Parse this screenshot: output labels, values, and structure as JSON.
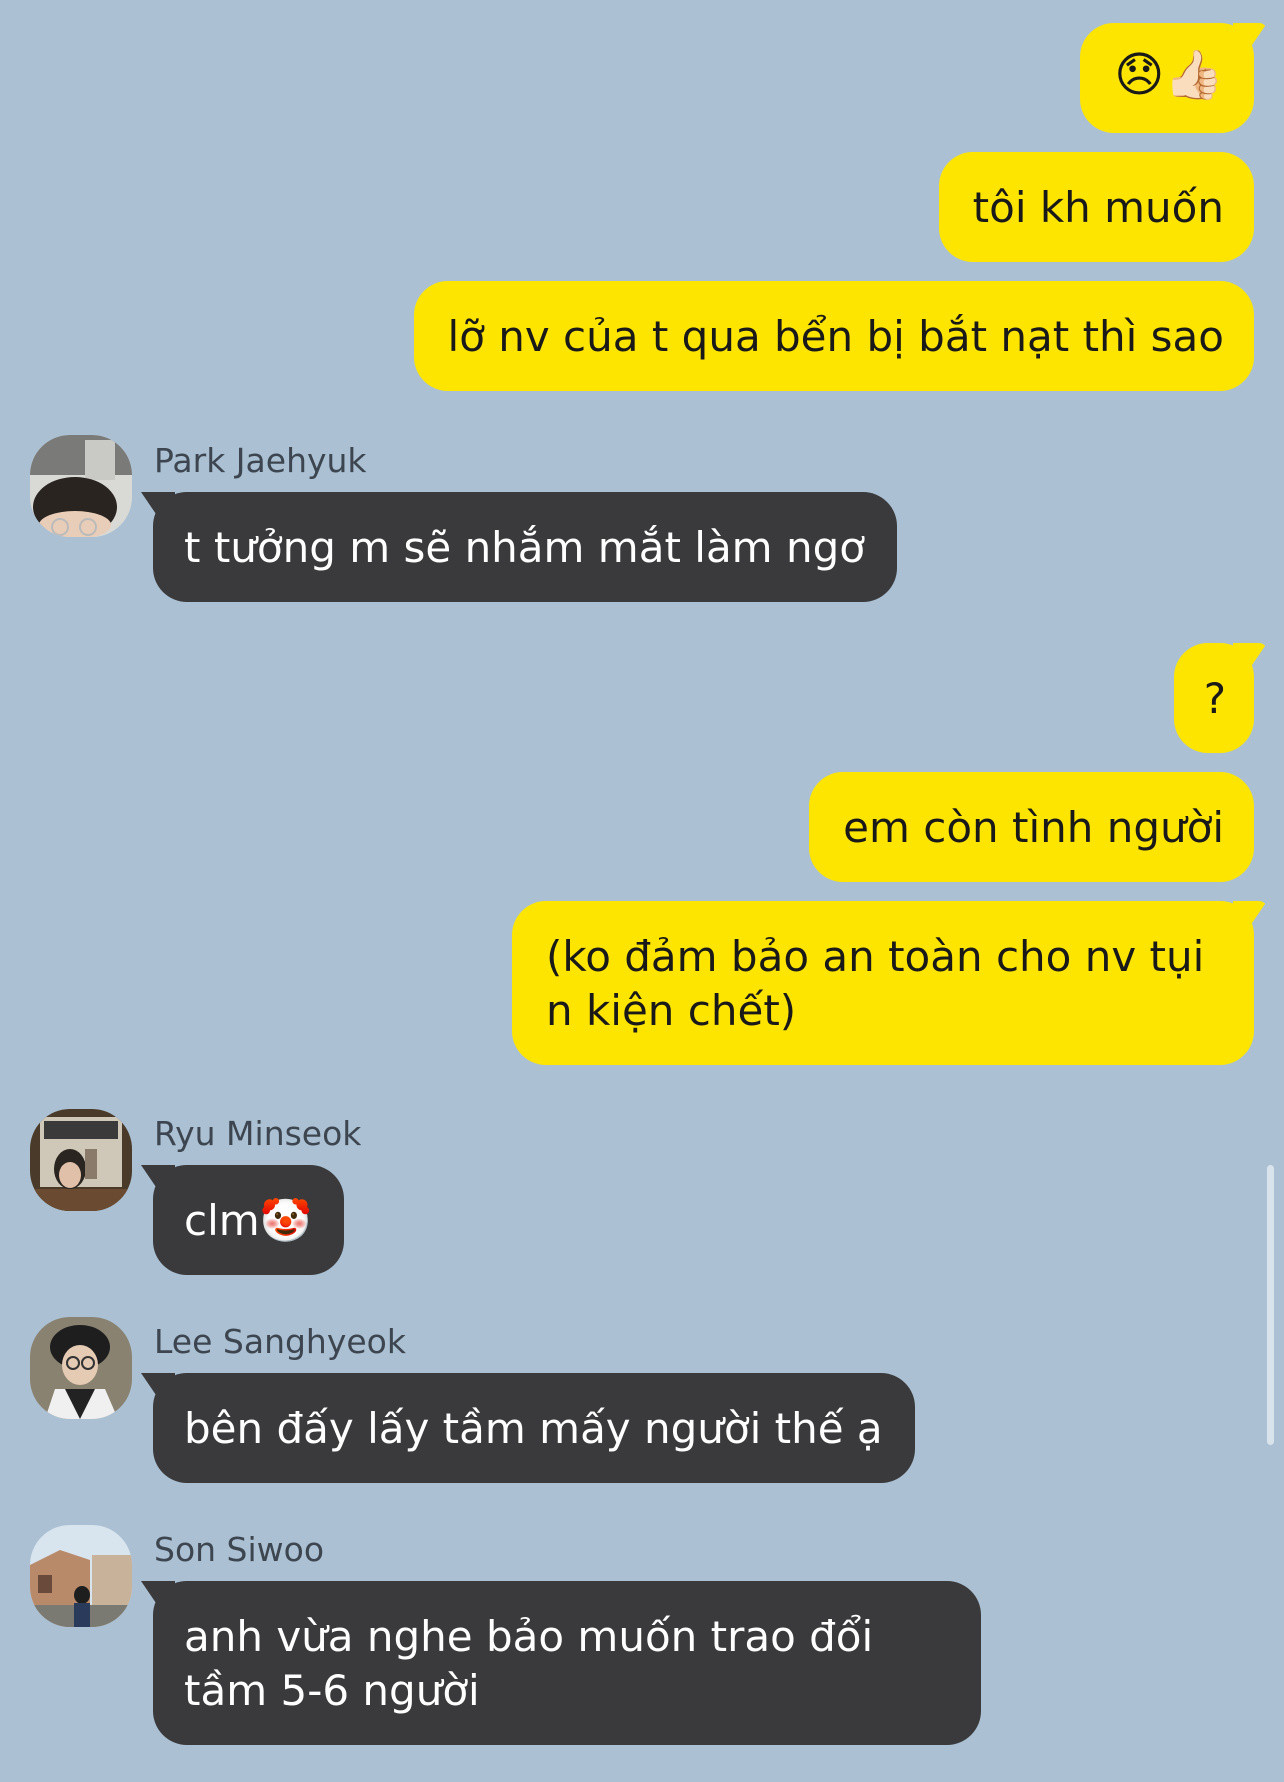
{
  "messages": {
    "out1": {
      "text": "😞👍🏻",
      "emoji": [
        "disappointed-face",
        "thumbs-up"
      ]
    },
    "out2": {
      "text": "tôi kh muốn"
    },
    "out3": {
      "text": "lỡ nv của t qua bển bị bắt nạt thì sao"
    },
    "in1": {
      "sender": "Park Jaehyuk",
      "text": "t tưởng m sẽ nhắm mắt làm ngơ"
    },
    "out4": {
      "text": "?"
    },
    "out5": {
      "text": "em còn tình người"
    },
    "out6": {
      "text": "(ko đảm bảo an toàn cho nv tụi n kiện chết)"
    },
    "in2": {
      "sender": "Ryu Minseok",
      "text": "clm🤡"
    },
    "in3": {
      "sender": "Lee Sanghyeok",
      "text": "bên đấy lấy tầm mấy người thế ạ"
    },
    "in4": {
      "sender": "Son Siwoo",
      "text": "anh vừa nghe bảo muốn trao đổi tầm 5-6 người"
    }
  },
  "colors": {
    "background": "#abc1d3",
    "outgoing_bubble": "#fee500",
    "incoming_bubble": "#3a3a3c"
  }
}
